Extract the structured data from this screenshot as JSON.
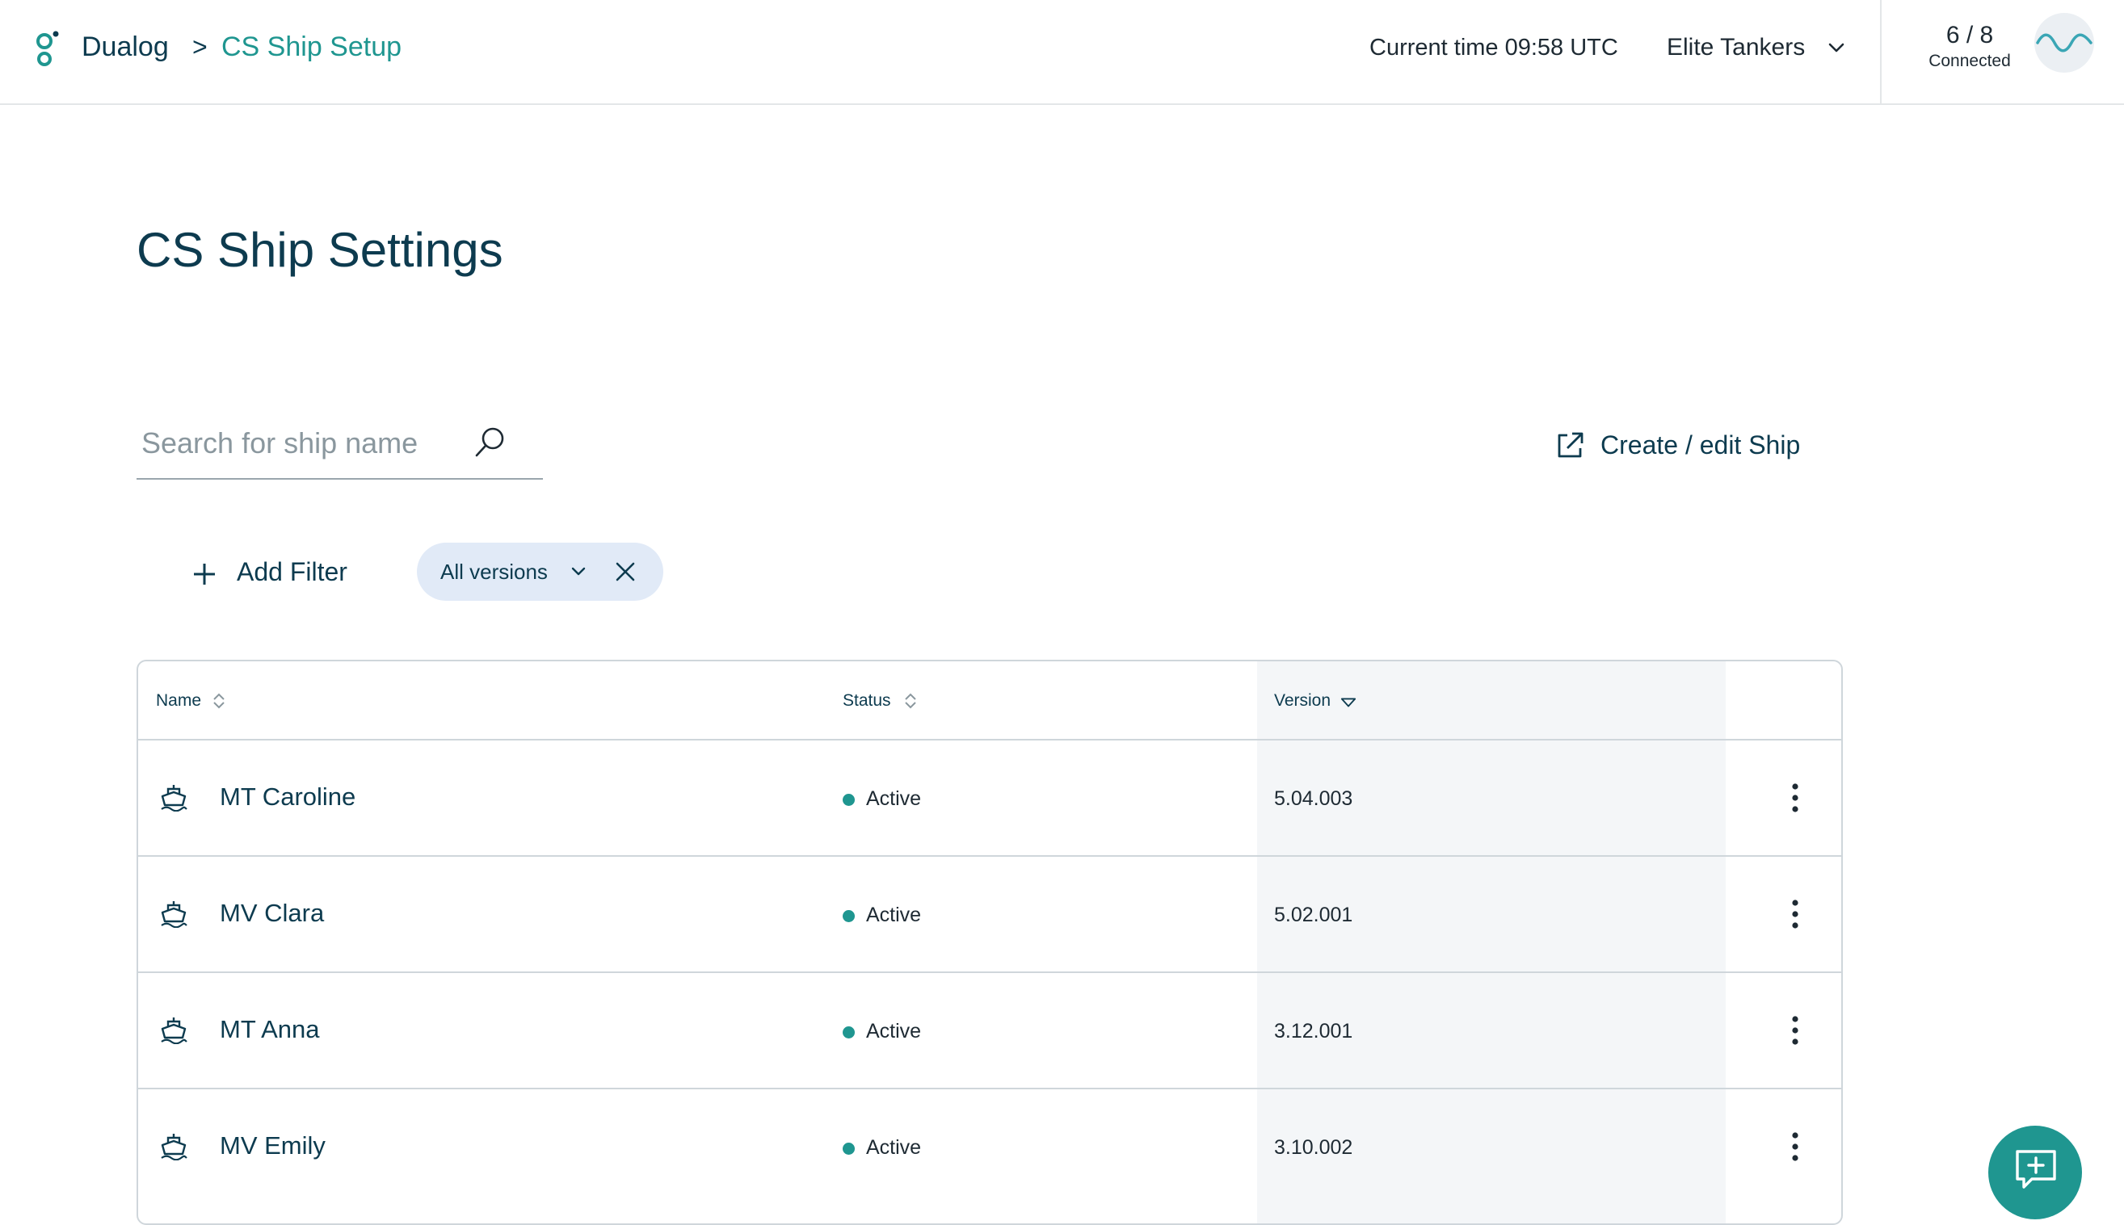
{
  "colors": {
    "brand_teal": "#1f9690",
    "text_dark": "#0d3b4f",
    "chip_bg": "#e1eaf7",
    "version_col_bg": "#f4f6f8",
    "status_active": "#1f9690"
  },
  "header": {
    "logo_icon": "dualog-logo-icon",
    "breadcrumb": {
      "root": "Dualog",
      "separator": ">",
      "current": "CS Ship Setup"
    },
    "time_label": "Current time 09:58 UTC",
    "company": {
      "selected": "Elite Tankers",
      "icon": "chevron-down-icon"
    },
    "connection": {
      "count": "6 / 8",
      "label": "Connected",
      "icon": "wave-icon"
    }
  },
  "main": {
    "title": "CS Ship Settings",
    "search": {
      "placeholder": "Search for ship name",
      "value": "",
      "icon": "search-icon"
    },
    "create_link": {
      "label": "Create / edit Ship",
      "icon": "external-link-icon"
    },
    "add_filter": {
      "label": "Add Filter",
      "icon": "plus-icon"
    },
    "filter_chip": {
      "label": "All versions",
      "icons": [
        "chevron-down-icon",
        "close-icon"
      ]
    }
  },
  "table": {
    "columns": [
      {
        "label": "Name",
        "sort_icon": "sort-both-icon"
      },
      {
        "label": "Status",
        "sort_icon": "sort-both-icon"
      },
      {
        "label": "Version",
        "sort_icon": "sort-desc-icon"
      }
    ],
    "rows": [
      {
        "name": "MT Caroline",
        "status": "Active",
        "version": "5.04.003"
      },
      {
        "name": "MV Clara",
        "status": "Active",
        "version": "5.02.001"
      },
      {
        "name": "MT Anna",
        "status": "Active",
        "version": "3.12.001"
      },
      {
        "name": "MV Emily",
        "status": "Active",
        "version": "3.10.002"
      }
    ],
    "row_icon": "ship-icon",
    "row_menu_icon": "more-vertical-icon"
  },
  "fab": {
    "icon": "feedback-add-icon"
  }
}
